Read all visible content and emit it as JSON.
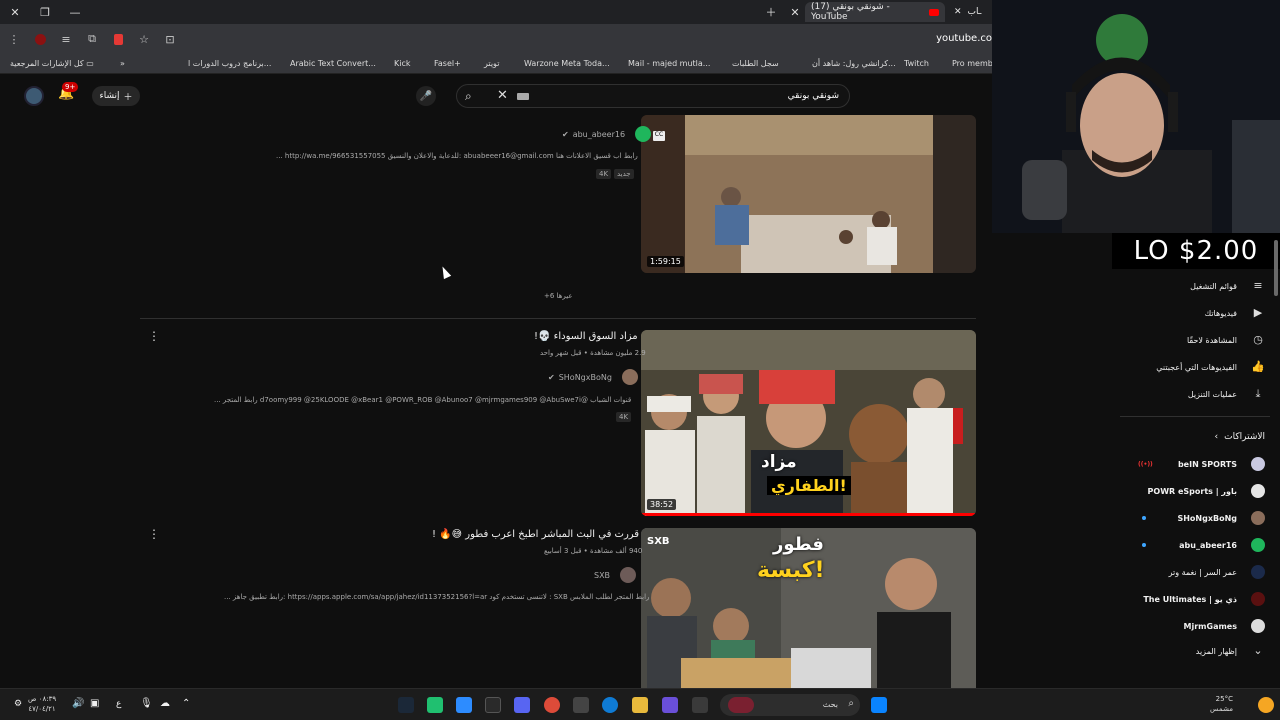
{
  "browser": {
    "tabs": [
      {
        "label": "(17) شونقي بونقي - YouTube",
        "active": true
      },
      {
        "label": "ـاب",
        "active": false
      }
    ],
    "url": "youtube.co",
    "bookmarks": {
      "all": "كل الإشارات المرجعية",
      "items": [
        "برنامج دروب الدورات ا...",
        "Arabic Text Convert...",
        "Kick",
        "Fasel+",
        "تويتر",
        "Warzone Meta Toda...",
        "Mail - majed mutla...",
        "سجل الطلبات",
        "كرانشي رول: شاهد أن...",
        "Twitch",
        "Pro membe"
      ]
    }
  },
  "youtube": {
    "create_label": "إنشاء",
    "notif_badge": "9+",
    "search_query": "شونقي بونقي",
    "results": [
      {
        "channel": "abu_abeer16",
        "description": "... http://wa.me/966531557055 للدعاية والاعلان والنسيق: abuabeeer16@gmail.com رابط اب قسيق الاعلانات هنا",
        "tags": [
          "جديد",
          "4K"
        ],
        "duration": "1:59:15",
        "more": "+6 عيرها"
      },
      {
        "title": "مزاد السوق السوداء 💀!",
        "meta": "2.9 مليون مشاهدة • قبل شهر واحد",
        "channel": "SHoNgxBoNg",
        "description": "... رابط المتجر d7oomy999 @25KLOODE @xBear1 @POWR_ROB @Abunoo7 @mjrmgames909 @AbuSwe7i@ قنوات الشباب",
        "tags": [
          "4K"
        ],
        "duration": "38:52",
        "thumb_text": [
          "مزاد",
          "الطفاري!"
        ]
      },
      {
        "title": "قررت في البث المباشر اطبخ اعرب فطور 😅🔥 !",
        "meta": "940 ألف مشاهدة • قبل 3 أسابيع",
        "channel": "SXB",
        "description": "... رابط تطبيق جاهز: https://apps.apple.com/sa/app/jahez/id1137352156?l=ar لاتنسى تستخدم كود : SXB رابط المتجر لطلب الملابس",
        "thumb_text": [
          "فطور",
          "كبسة!"
        ],
        "thumb_badge": "SXB"
      }
    ]
  },
  "overlay": {
    "price": "LO $2.00"
  },
  "sidebar": {
    "items": [
      "قوائم التشغيل",
      "فيديوهاتك",
      "المشاهدة لاحقًا",
      "الفيديوهات التي أعجبتني",
      "عمليات التنزيل"
    ],
    "subs_header": "الاشتراكات",
    "subs": [
      "beIN SPORTS",
      "POWR eSports | باور",
      "SHoNgxBoNg",
      "abu_abeer16",
      "عمر السر | نغمة وتر",
      "The Ultimates | ذي يو",
      "MjrmGames"
    ],
    "show_more": "إظهار المزيد"
  },
  "taskbar": {
    "search_label": "بحث",
    "time": "٠٨:٣٩ ص",
    "date": "٤٧/٠٤/٢١",
    "weather_temp": "25°C",
    "weather_desc": "مشمس",
    "lang": "ع"
  }
}
